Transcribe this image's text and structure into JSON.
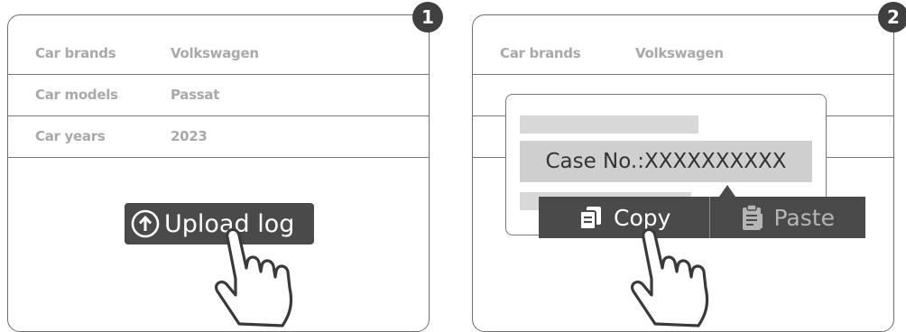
{
  "panel1": {
    "badge": "1",
    "rows": [
      {
        "label": "Car brands",
        "value": "Volkswagen"
      },
      {
        "label": "Car models",
        "value": "Passat"
      },
      {
        "label": "Car years",
        "value": "2023"
      }
    ],
    "upload_button_label": "Upload log",
    "upload_icon": "upload-arrow-icon",
    "hand_icon": "pointing-hand-icon"
  },
  "panel2": {
    "badge": "2",
    "rows": [
      {
        "label": "Car brands",
        "value": "Volkswagen"
      }
    ],
    "case_number_text": "Case No.:XXXXXXXXXX",
    "context_menu": {
      "copy_label": "Copy",
      "copy_icon": "copy-icon",
      "paste_label": "Paste",
      "paste_icon": "paste-icon"
    },
    "hand_icon": "pointing-hand-icon"
  },
  "colors": {
    "dark": "#4a4a4a",
    "badge": "#404040",
    "muted_text": "#a9a9a9",
    "divider": "#777777",
    "highlight": "#cfcfcf"
  }
}
